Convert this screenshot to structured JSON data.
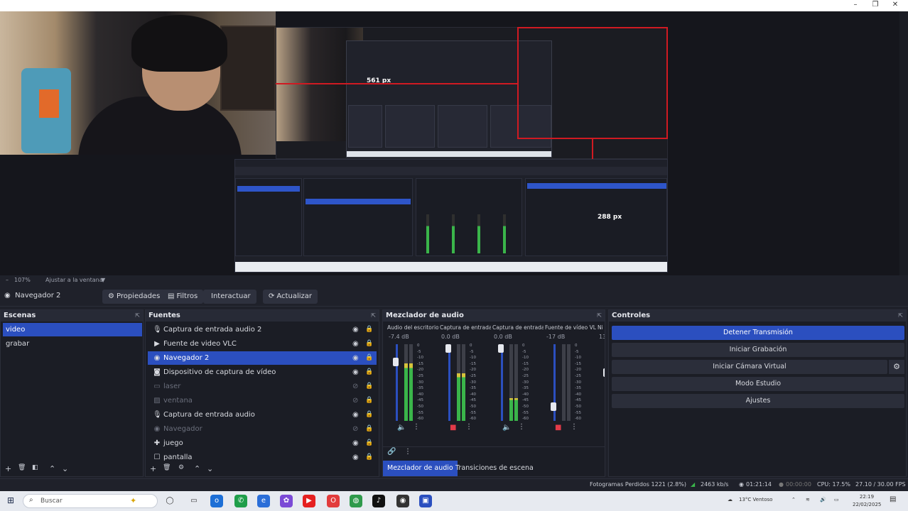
{
  "window": {
    "title_icon": "obs-icon",
    "controls": [
      "–",
      "❐",
      "✕"
    ]
  },
  "preview": {
    "label_px1": "561 px",
    "label_px2": "288 px"
  },
  "zoom": {
    "level": "107%",
    "fit": "Ajustar a la ventana"
  },
  "source_toolbar": {
    "selected_source": "Navegador 2",
    "properties": "Propiedades",
    "filters": "Filtros",
    "interact": "Interactuar",
    "refresh": "Actualizar"
  },
  "scenes": {
    "title": "Escenas",
    "items": [
      {
        "label": "video",
        "active": true
      },
      {
        "label": "grabar",
        "active": false
      }
    ]
  },
  "sources": {
    "title": "Fuentes",
    "items": [
      {
        "label": "Captura de entrada audio 2",
        "icon": "mic-icon",
        "active": false,
        "visible": true
      },
      {
        "label": "Fuente de video VLC",
        "icon": "play-icon",
        "active": false,
        "visible": true
      },
      {
        "label": "Navegador 2",
        "icon": "globe-icon",
        "active": true,
        "visible": true
      },
      {
        "label": "Dispositivo de captura de vídeo",
        "icon": "camera-icon",
        "active": false,
        "visible": true
      },
      {
        "label": "laser",
        "icon": "monitor-icon",
        "active": false,
        "visible": false
      },
      {
        "label": "ventana",
        "icon": "image-icon",
        "active": false,
        "visible": false
      },
      {
        "label": "Captura de entrada audio",
        "icon": "mic-icon",
        "active": false,
        "visible": true
      },
      {
        "label": "Navegador",
        "icon": "globe-icon",
        "active": false,
        "visible": false
      },
      {
        "label": "juego",
        "icon": "gamepad-icon",
        "active": false,
        "visible": true
      },
      {
        "label": "pantalla",
        "icon": "window-icon",
        "active": false,
        "visible": true
      }
    ]
  },
  "mixer": {
    "title": "Mezclador de audio",
    "channels": [
      {
        "name": "Audio del escritorio",
        "db": "-7.4 dB",
        "level": 0.75,
        "muted": false,
        "knob": 0.2
      },
      {
        "name": "Captura de entrada",
        "db": "0.0 dB",
        "level": 0.62,
        "muted": true,
        "knob": 0.0
      },
      {
        "name": "Captura de entrada",
        "db": "0.0 dB",
        "level": 0.3,
        "muted": false,
        "knob": 0.0
      },
      {
        "name": "Fuente de vídeo VL",
        "db": "-17 dB",
        "level": 0.0,
        "muted": true,
        "knob": 0.85
      },
      {
        "name": "Ni",
        "db": "13",
        "level": 0.0,
        "muted": true,
        "knob": 0.35
      }
    ],
    "scale": [
      "0",
      "-5",
      "-10",
      "-15",
      "-20",
      "-25",
      "-30",
      "-35",
      "-40",
      "-45",
      "-50",
      "-55",
      "-60"
    ],
    "tabs": {
      "mixer": "Mezclador de audio",
      "transitions": "Transiciones de escena"
    }
  },
  "controls": {
    "title": "Controles",
    "stop_stream": "Detener Transmisión",
    "start_record": "Iniciar Grabación",
    "start_vcam": "Iniciar Cámara Virtual",
    "studio": "Modo Estudio",
    "settings": "Ajustes"
  },
  "status": {
    "dropped": "Fotogramas Perdidos 1221 (2.8%)",
    "bitrate": "2463 kb/s",
    "live_time": "01:21:14",
    "rec_time": "00:00:00",
    "cpu": "CPU: 17.5%",
    "fps": "27.10 / 30.00 FPS"
  },
  "taskbar": {
    "search_placeholder": "Buscar",
    "weather": "13°C Ventoso",
    "time": "22:19",
    "date": "22/02/2025"
  },
  "colors": {
    "accent": "#2b4fbf",
    "red_guide": "#d01a22",
    "meter_green": "#3ab54a"
  }
}
